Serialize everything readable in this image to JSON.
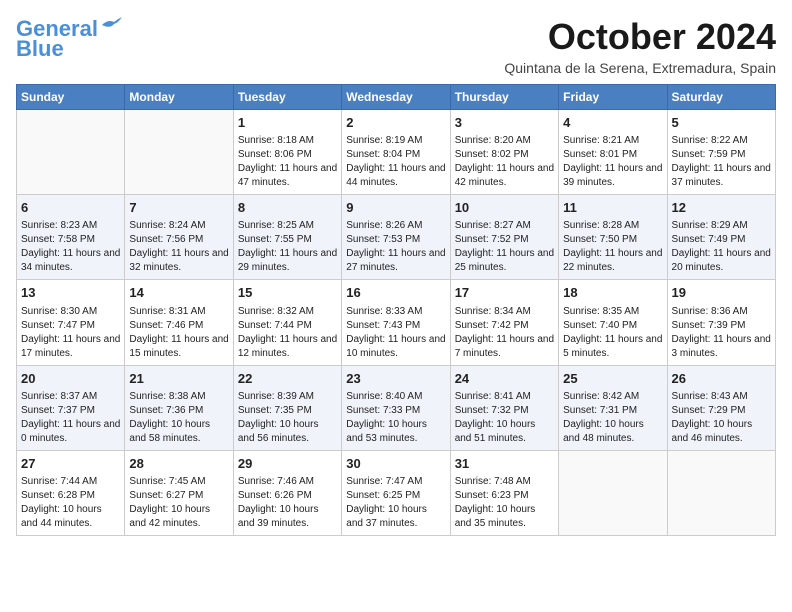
{
  "header": {
    "logo_line1": "General",
    "logo_line2": "Blue",
    "month": "October 2024",
    "location": "Quintana de la Serena, Extremadura, Spain"
  },
  "weekdays": [
    "Sunday",
    "Monday",
    "Tuesday",
    "Wednesday",
    "Thursday",
    "Friday",
    "Saturday"
  ],
  "weeks": [
    [
      {
        "day": "",
        "info": ""
      },
      {
        "day": "",
        "info": ""
      },
      {
        "day": "1",
        "info": "Sunrise: 8:18 AM\nSunset: 8:06 PM\nDaylight: 11 hours and 47 minutes."
      },
      {
        "day": "2",
        "info": "Sunrise: 8:19 AM\nSunset: 8:04 PM\nDaylight: 11 hours and 44 minutes."
      },
      {
        "day": "3",
        "info": "Sunrise: 8:20 AM\nSunset: 8:02 PM\nDaylight: 11 hours and 42 minutes."
      },
      {
        "day": "4",
        "info": "Sunrise: 8:21 AM\nSunset: 8:01 PM\nDaylight: 11 hours and 39 minutes."
      },
      {
        "day": "5",
        "info": "Sunrise: 8:22 AM\nSunset: 7:59 PM\nDaylight: 11 hours and 37 minutes."
      }
    ],
    [
      {
        "day": "6",
        "info": "Sunrise: 8:23 AM\nSunset: 7:58 PM\nDaylight: 11 hours and 34 minutes."
      },
      {
        "day": "7",
        "info": "Sunrise: 8:24 AM\nSunset: 7:56 PM\nDaylight: 11 hours and 32 minutes."
      },
      {
        "day": "8",
        "info": "Sunrise: 8:25 AM\nSunset: 7:55 PM\nDaylight: 11 hours and 29 minutes."
      },
      {
        "day": "9",
        "info": "Sunrise: 8:26 AM\nSunset: 7:53 PM\nDaylight: 11 hours and 27 minutes."
      },
      {
        "day": "10",
        "info": "Sunrise: 8:27 AM\nSunset: 7:52 PM\nDaylight: 11 hours and 25 minutes."
      },
      {
        "day": "11",
        "info": "Sunrise: 8:28 AM\nSunset: 7:50 PM\nDaylight: 11 hours and 22 minutes."
      },
      {
        "day": "12",
        "info": "Sunrise: 8:29 AM\nSunset: 7:49 PM\nDaylight: 11 hours and 20 minutes."
      }
    ],
    [
      {
        "day": "13",
        "info": "Sunrise: 8:30 AM\nSunset: 7:47 PM\nDaylight: 11 hours and 17 minutes."
      },
      {
        "day": "14",
        "info": "Sunrise: 8:31 AM\nSunset: 7:46 PM\nDaylight: 11 hours and 15 minutes."
      },
      {
        "day": "15",
        "info": "Sunrise: 8:32 AM\nSunset: 7:44 PM\nDaylight: 11 hours and 12 minutes."
      },
      {
        "day": "16",
        "info": "Sunrise: 8:33 AM\nSunset: 7:43 PM\nDaylight: 11 hours and 10 minutes."
      },
      {
        "day": "17",
        "info": "Sunrise: 8:34 AM\nSunset: 7:42 PM\nDaylight: 11 hours and 7 minutes."
      },
      {
        "day": "18",
        "info": "Sunrise: 8:35 AM\nSunset: 7:40 PM\nDaylight: 11 hours and 5 minutes."
      },
      {
        "day": "19",
        "info": "Sunrise: 8:36 AM\nSunset: 7:39 PM\nDaylight: 11 hours and 3 minutes."
      }
    ],
    [
      {
        "day": "20",
        "info": "Sunrise: 8:37 AM\nSunset: 7:37 PM\nDaylight: 11 hours and 0 minutes."
      },
      {
        "day": "21",
        "info": "Sunrise: 8:38 AM\nSunset: 7:36 PM\nDaylight: 10 hours and 58 minutes."
      },
      {
        "day": "22",
        "info": "Sunrise: 8:39 AM\nSunset: 7:35 PM\nDaylight: 10 hours and 56 minutes."
      },
      {
        "day": "23",
        "info": "Sunrise: 8:40 AM\nSunset: 7:33 PM\nDaylight: 10 hours and 53 minutes."
      },
      {
        "day": "24",
        "info": "Sunrise: 8:41 AM\nSunset: 7:32 PM\nDaylight: 10 hours and 51 minutes."
      },
      {
        "day": "25",
        "info": "Sunrise: 8:42 AM\nSunset: 7:31 PM\nDaylight: 10 hours and 48 minutes."
      },
      {
        "day": "26",
        "info": "Sunrise: 8:43 AM\nSunset: 7:29 PM\nDaylight: 10 hours and 46 minutes."
      }
    ],
    [
      {
        "day": "27",
        "info": "Sunrise: 7:44 AM\nSunset: 6:28 PM\nDaylight: 10 hours and 44 minutes."
      },
      {
        "day": "28",
        "info": "Sunrise: 7:45 AM\nSunset: 6:27 PM\nDaylight: 10 hours and 42 minutes."
      },
      {
        "day": "29",
        "info": "Sunrise: 7:46 AM\nSunset: 6:26 PM\nDaylight: 10 hours and 39 minutes."
      },
      {
        "day": "30",
        "info": "Sunrise: 7:47 AM\nSunset: 6:25 PM\nDaylight: 10 hours and 37 minutes."
      },
      {
        "day": "31",
        "info": "Sunrise: 7:48 AM\nSunset: 6:23 PM\nDaylight: 10 hours and 35 minutes."
      },
      {
        "day": "",
        "info": ""
      },
      {
        "day": "",
        "info": ""
      }
    ]
  ]
}
